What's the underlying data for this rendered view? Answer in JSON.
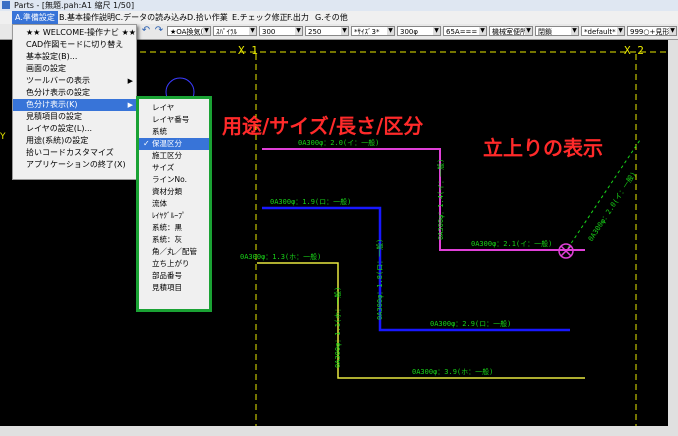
{
  "window": {
    "title": "Parts - [無題.pah:A1 縮尺 1/50]"
  },
  "menubar": {
    "items": [
      {
        "label": "A.準備設定",
        "active": true
      },
      {
        "label": "B.基本操作説明"
      },
      {
        "label": "C.データの読み込み"
      },
      {
        "label": "D.拾い作業"
      },
      {
        "label": "E.チェック修正"
      },
      {
        "label": "F.出力"
      },
      {
        "label": "G.その他"
      }
    ]
  },
  "toolbar": {
    "combos": [
      "★OA換気(",
      "ｽﾊﾟｲﾗﾙ",
      "300",
      "250",
      "*ｻｲｽﾞ3*",
      "300φ",
      "65A===",
      "機械室便所",
      "閉鎖",
      "*default*",
      "999○+見形"
    ]
  },
  "main_menu": {
    "items": [
      {
        "label": "★★ WELCOME-操作ナビ ★★"
      },
      {
        "label": "CAD作図モードに切り替え"
      },
      {
        "label": "基本設定(B)..."
      },
      {
        "label": "画面の設定"
      },
      {
        "label": "ツールバーの表示",
        "submenu": true
      },
      {
        "label": "色分け表示の設定"
      },
      {
        "label": "色分け表示(K)",
        "submenu": true,
        "highlighted": true
      },
      {
        "label": "見積項目の設定"
      },
      {
        "label": "レイヤの設定(L)..."
      },
      {
        "label": "用途(系統)の設定"
      },
      {
        "label": "拾いコードカスタマイズ"
      },
      {
        "label": "アプリケーションの終了(X)"
      }
    ]
  },
  "submenu": {
    "items": [
      {
        "label": "レイヤ"
      },
      {
        "label": "レイヤ番号"
      },
      {
        "label": "系統"
      },
      {
        "label": "保温区分",
        "checked": true
      },
      {
        "label": "施工区分"
      },
      {
        "label": "サイズ"
      },
      {
        "label": "ラインNo."
      },
      {
        "label": "資材分類"
      },
      {
        "label": "流体"
      },
      {
        "label": "ﾚｲﾔｸﾞﾙｰﾌﾟ"
      },
      {
        "label": "系統：黒"
      },
      {
        "label": "系統：灰"
      },
      {
        "label": "角／丸／配管"
      },
      {
        "label": "立ち上がり"
      },
      {
        "label": "部品番号"
      },
      {
        "label": "見積項目"
      }
    ]
  },
  "canvas": {
    "axis_labels": [
      "X 1",
      "X 2"
    ],
    "y_label": "Y",
    "annotation_main": "用途/サイズ/長さ/区分",
    "annotation_riser": "立上りの表示",
    "pipe_labels": [
      "0A300φ：2.0(イ：一般)",
      "0A300φ：1.9(ロ：一般)",
      "0A300φ：1.3(ホ：一般)",
      "0A300φ：2.1(イ：一般)",
      "0A300φ：2.9(ロ：一般)",
      "0A300φ：3.9(ホ：一般)"
    ],
    "vertical_labels": [
      "0A300φ：1.4(イ：一般)",
      "0A300φ：1.8(ロ：一般)",
      "0A300φ：1.1(ホ：一般)",
      "0A300φ：2.0(イ：一般)"
    ],
    "colors": {
      "pipe_i": "#e040d8",
      "pipe_ro": "#1818ff",
      "pipe_ho": "#e8e840",
      "grid": "#e8e800",
      "label": "#18d418",
      "annot": "#ff2a2a"
    }
  }
}
